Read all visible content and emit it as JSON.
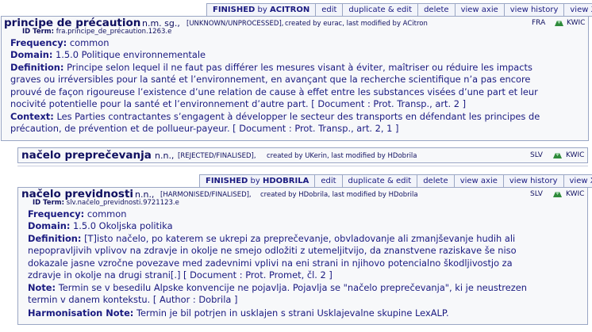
{
  "entries": [
    {
      "toolbar": {
        "status_prefix": "FINISHED",
        "status_by": "by",
        "status_user": "ACITRON",
        "edit": "edit",
        "duplicate_edit": "duplicate & edit",
        "delete": "delete",
        "view_axie": "view axie",
        "view_history": "view history",
        "view_xml": "view XML"
      },
      "term": "principe de précaution",
      "grammar": "n.m. sg.,",
      "status": "[UNKNOWN/UNPROCESSED],",
      "meta": "created by eurac, last modified by ACitron",
      "id_label": "ID Term:",
      "id_value": "fra.principe_de_précaution.1263.e",
      "lang": "FRA",
      "kwic": "KWIC",
      "frequency_label": "Frequency:",
      "frequency_value": "common",
      "domain_label": "Domain:",
      "domain_value": "1.5.0 Politique environnementale",
      "definition_label": "Definition:",
      "definition_lines": [
        "Principe selon lequel il ne faut pas différer les mesures visant à éviter, maîtriser ou réduire les impacts",
        "graves ou irréversibles pour la santé et l’environnement, en avançant que la recherche scientifique n’a pas encore",
        "prouvé de façon rigoureuse l’existence d’une relation de cause à effet entre les substances visées d’une part et leur",
        "nocivité potentielle pour la santé et l’environnement d’autre part. [ Document : Prot. Transp., art. 2 ]"
      ],
      "context_label": "Context:",
      "context_lines": [
        "Les Parties contractantes s’engagent à développer le secteur des transports en défendant les principes de",
        "précaution, de prévention et de pollueur-payeur. [ Document : Prot. Transp., art. 2, 1 ]"
      ]
    },
    {
      "term": "načelo preprečevanja",
      "grammar": "n.n.,",
      "status": "[REJECTED/FINALISED],",
      "meta": "created by UKerin, last modified by HDobrila",
      "lang": "SLV",
      "kwic": "KWIC"
    },
    {
      "toolbar": {
        "status_prefix": "FINISHED",
        "status_by": "by",
        "status_user": "HDOBRILA",
        "edit": "edit",
        "duplicate_edit": "duplicate & edit",
        "delete": "delete",
        "view_axie": "view axie",
        "view_history": "view history",
        "view_xml": "view XML"
      },
      "term": "načelo previdnosti",
      "grammar": "n.n.,",
      "status": "[HARMONISED/FINALISED],",
      "meta": "created by HDobrila, last modified by HDobrila",
      "id_label": "ID Term:",
      "id_value": "slv.načelo_previdnosti.9721123.e",
      "lang": "SLV",
      "kwic": "KWIC",
      "frequency_label": "Frequency:",
      "frequency_value": "common",
      "domain_label": "Domain:",
      "domain_value": "1.5.0 Okoljska politika",
      "definition_label": "Definition:",
      "definition_lines": [
        "[T]isto načelo, po katerem se ukrepi za preprečevanje, obvladovanje ali zmanjševanje hudih ali",
        "nepopravljivih vplivov na zdravje in okolje ne smejo odložiti z utemeljitvijo, da znanstvene raziskave še niso",
        "dokazale jasne vzročne povezave med zadevnimi vplivi na eni strani in njihovo potencialno škodljivostjo za",
        "zdravje in okolje na drugi strani[.] [ Document : Prot. Promet, čl. 2 ]"
      ],
      "note_label": "Note:",
      "note_lines": [
        "Termin se v besedilu Alpske konvencije ne pojavlja. Pojavlja se \"načelo preprečevanja\", ki je neustrezen",
        "termin v danem kontekstu. [ Author : Dobrila ]"
      ],
      "harm_label": "Harmonisation Note:",
      "harm_value": "Termin je bil potrjen in usklajen s strani Usklajevalne skupine LexALP."
    }
  ],
  "colors": {
    "text": "#1a1a80",
    "border": "#9aa6c4",
    "card_bg": "#f7f8fa",
    "toolbar_bg": "#f2f4fa",
    "kwic_green": "#2e8b3a"
  }
}
